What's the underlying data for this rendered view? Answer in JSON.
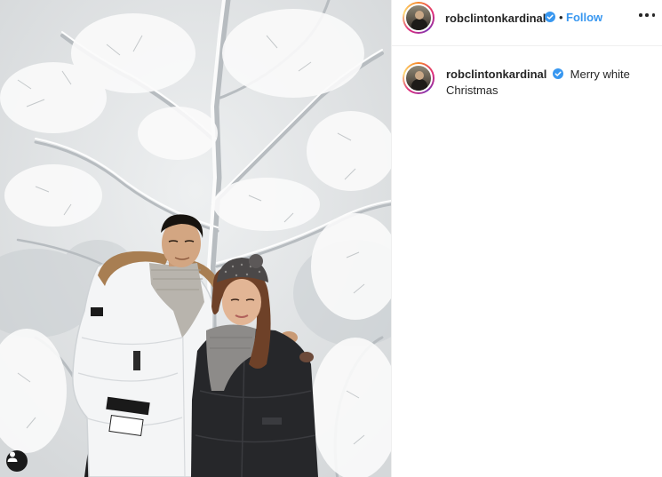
{
  "post": {
    "photo": {
      "alt_icon": "user-tag-icon"
    },
    "header": {
      "username": "robclintonkardinal",
      "verified_icon": "verified-badge-icon",
      "separator": "•",
      "follow_label": "Follow",
      "more_icon": "more-options-icon"
    },
    "caption": {
      "username": "robclintonkardinal",
      "verified_icon": "verified-badge-icon",
      "text": "Merry white Christmas"
    }
  },
  "colors": {
    "accent": "#3897f0",
    "verified": "#3897f0",
    "text": "#262626",
    "border": "#efefef"
  }
}
